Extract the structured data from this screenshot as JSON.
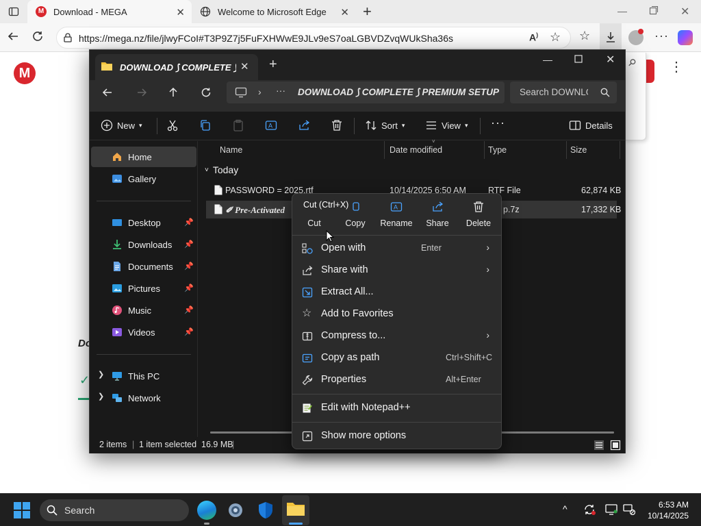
{
  "browser": {
    "tabs": [
      {
        "title": "Download - MEGA",
        "active": true
      },
      {
        "title": "Welcome to Microsoft Edge",
        "active": false
      }
    ],
    "url": "https://mega.nz/file/jlwyFCoI#T3P9Z7j5FuFXHWwE9JLv9eS7oaLGBVDZvqWUkSha36s"
  },
  "webpage": {
    "logo": "M",
    "partial_heading": "Do"
  },
  "explorer": {
    "tab_title": "DOWNLOAD ⟆ COMPLETE ⟆ PREMIUM SETUP",
    "path": "DOWNLOAD ⟆ COMPLETE ⟆ PREMIUM SETUP",
    "path_ellipsis": "···",
    "search_placeholder": "Search DOWNLOAD",
    "toolbar": {
      "new": "New",
      "sort": "Sort",
      "view": "View",
      "more": "···",
      "details": "Details"
    },
    "sidebar": {
      "home": "Home",
      "gallery": "Gallery",
      "desktop": "Desktop",
      "downloads": "Downloads",
      "documents": "Documents",
      "pictures": "Pictures",
      "music": "Music",
      "videos": "Videos",
      "this_pc": "This PC",
      "network": "Network"
    },
    "columns": {
      "name": "Name",
      "date": "Date modified",
      "type": "Type",
      "size": "Size"
    },
    "group_label": "Today",
    "files": [
      {
        "name": "PASSWORD =  2025.rtf",
        "date": "10/14/2025 6:50 AM",
        "type": "RTF File",
        "size": "62,874 KB"
      },
      {
        "name": "✐ Pre-Activated",
        "date": "",
        "type": "p.7z",
        "size": "17,332 KB"
      }
    ],
    "status": {
      "items": "2 items",
      "selected": "1 item selected  16.9 MB"
    }
  },
  "context_menu": {
    "tooltip": "Cut (Ctrl+X)",
    "quick_actions": {
      "cut": "Cut",
      "copy": "Copy",
      "rename": "Rename",
      "share": "Share",
      "delete": "Delete"
    },
    "items": {
      "open_with": "Open with",
      "open_with_sc": "Enter",
      "share_with": "Share with",
      "extract": "Extract All...",
      "favorites": "Add to Favorites",
      "compress": "Compress to...",
      "copy_path": "Copy as path",
      "copy_path_sc": "Ctrl+Shift+C",
      "properties": "Properties",
      "properties_sc": "Alt+Enter",
      "notepad": "Edit with Notepad++",
      "more_options": "Show more options"
    }
  },
  "taskbar": {
    "search": "Search",
    "time": "6:53 AM",
    "date": "10/14/2025"
  },
  "colors": {
    "mega_red": "#d9272e",
    "explorer_bg": "#191919",
    "menu_bg": "#2b2b2b",
    "folder_yellow": "#f3c33b"
  }
}
